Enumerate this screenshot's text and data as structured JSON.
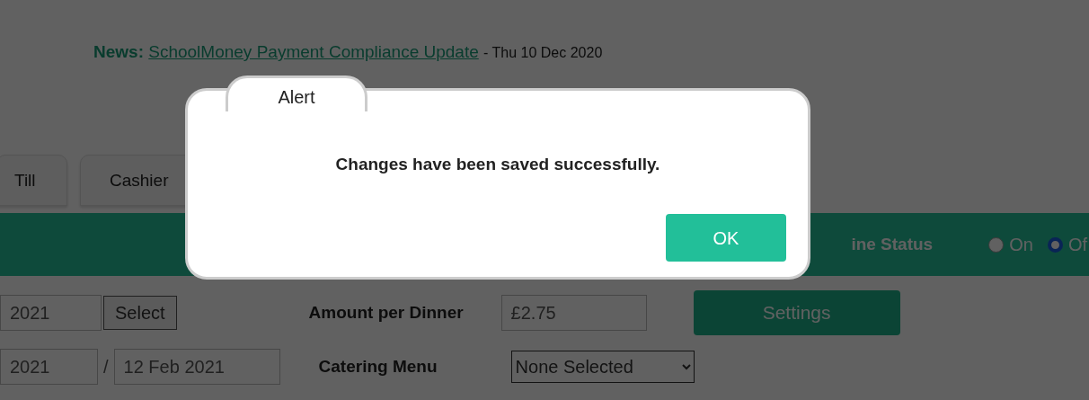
{
  "news": {
    "label": "News:",
    "link": "SchoolMoney Payment Compliance Update",
    "date": "- Thu 10 Dec 2020"
  },
  "tabs": [
    {
      "label": "Till",
      "selected": false
    },
    {
      "label": "Cashier",
      "selected": false
    }
  ],
  "status_bar": {
    "label": "ine Status",
    "options": [
      {
        "label": "On",
        "selected": false
      },
      {
        "label": "Of",
        "selected": true
      }
    ]
  },
  "form": {
    "date_from": "2021",
    "select_button": "Select",
    "range_start": "2021",
    "separator": "/",
    "range_end": "12 Feb 2021",
    "amount_label": "Amount per Dinner",
    "amount": "£2.75",
    "settings_button": "Settings",
    "menu_label": "Catering Menu",
    "menu_value": "None Selected"
  },
  "dialog": {
    "title": "Alert",
    "message": "Changes have been saved successfully.",
    "button": "OK"
  }
}
